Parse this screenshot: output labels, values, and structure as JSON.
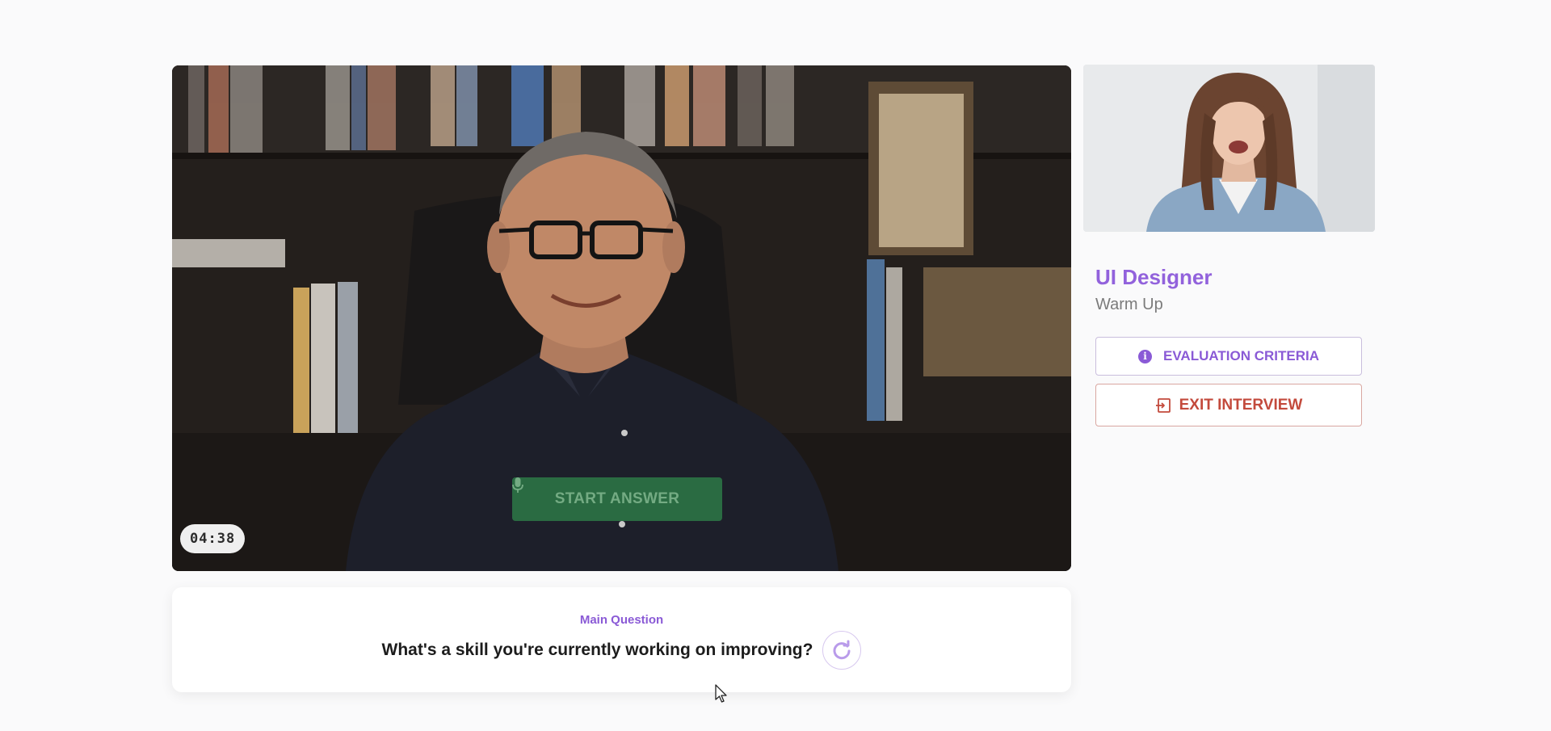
{
  "interview": {
    "timer": "04:38",
    "start_answer_label": "START ANSWER",
    "question_label": "Main Question",
    "question_text": "What's a skill you're currently working on improving?"
  },
  "side_panel": {
    "role": "UI Designer",
    "stage": "Warm Up",
    "evaluation_button": "EVALUATION CRITERIA",
    "exit_button": "EXIT INTERVIEW"
  },
  "icons": {
    "start": "microphone-icon",
    "replay": "replay-icon",
    "evaluation": "info-icon",
    "exit": "exit-icon"
  },
  "colors": {
    "accent": "#8a5ad6",
    "start_button": "#2e8249",
    "exit": "#c34a3c"
  }
}
